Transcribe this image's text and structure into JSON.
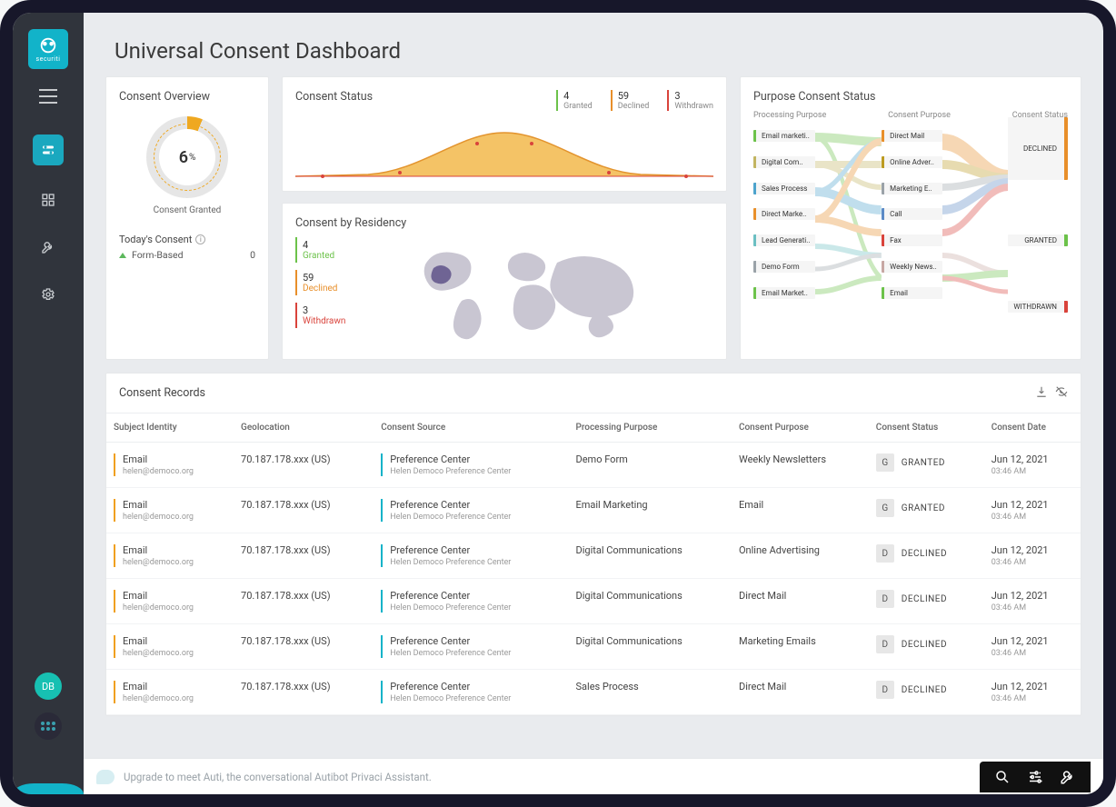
{
  "brand": {
    "name": "securiti"
  },
  "user": {
    "initials": "DB"
  },
  "header": {
    "title": "Universal Consent Dashboard"
  },
  "overview": {
    "title": "Consent Overview",
    "gauge_value": "6",
    "gauge_unit": "%",
    "gauge_label": "Consent Granted",
    "today_title": "Today's Consent",
    "today_item_label": "Form-Based",
    "today_item_value": "0"
  },
  "status": {
    "title": "Consent Status",
    "kpis": [
      {
        "value": "4",
        "label": "Granted",
        "color": "green"
      },
      {
        "value": "59",
        "label": "Declined",
        "color": "orange"
      },
      {
        "value": "3",
        "label": "Withdrawn",
        "color": "red"
      }
    ]
  },
  "residency": {
    "title": "Consent by Residency",
    "rows": [
      {
        "value": "4",
        "label": "Granted",
        "color": "green"
      },
      {
        "value": "59",
        "label": "Declined",
        "color": "orange"
      },
      {
        "value": "3",
        "label": "Withdrawn",
        "color": "red"
      }
    ]
  },
  "sankey": {
    "title": "Purpose Consent Status",
    "col_labels": [
      "Processing Purpose",
      "Consent Purpose",
      "Consent Status"
    ],
    "left": [
      {
        "label": "Email marketi..",
        "color": "#6cc24a"
      },
      {
        "label": "Digital Com..",
        "color": "#c2b561"
      },
      {
        "label": "Sales Process",
        "color": "#4da3cc"
      },
      {
        "label": "Direct Marke..",
        "color": "#e88f2a"
      },
      {
        "label": "Lead Generati..",
        "color": "#6bbfc2"
      },
      {
        "label": "Demo Form",
        "color": "#9aa2a8"
      },
      {
        "label": "Email Market..",
        "color": "#6cc24a"
      }
    ],
    "middle": [
      {
        "label": "Direct Mail",
        "color": "#e88f2a"
      },
      {
        "label": "Online Adver..",
        "color": "#bc9b21"
      },
      {
        "label": "Marketing E..",
        "color": "#9aa2a8"
      },
      {
        "label": "Call",
        "color": "#5b8ac6"
      },
      {
        "label": "Fax",
        "color": "#d9433b"
      },
      {
        "label": "Weekly News..",
        "color": "#c7a7a3"
      },
      {
        "label": "Email",
        "color": "#6cc24a"
      }
    ],
    "right": [
      {
        "label": "DECLINED",
        "color": "#e88f2a"
      },
      {
        "label": "GRANTED",
        "color": "#6cc24a"
      },
      {
        "label": "WITHDRAWN",
        "color": "#d9433b"
      }
    ]
  },
  "records": {
    "title": "Consent Records",
    "columns": [
      "Subject Identity",
      "Geolocation",
      "Consent Source",
      "Processing Purpose",
      "Consent Purpose",
      "Consent Status",
      "Consent Date"
    ],
    "rows": [
      {
        "identity_type": "Email",
        "identity_value": "helen@democo.org",
        "geo": "70.187.178.xxx (US)",
        "source_title": "Preference Center",
        "source_sub": "Helen Democo Preference Center",
        "purpose": "Demo Form",
        "consent_purpose": "Weekly Newsletters",
        "status_letter": "G",
        "status_text": "GRANTED",
        "date": "Jun 12, 2021",
        "time": "03:46 AM"
      },
      {
        "identity_type": "Email",
        "identity_value": "helen@democo.org",
        "geo": "70.187.178.xxx (US)",
        "source_title": "Preference Center",
        "source_sub": "Helen Democo Preference Center",
        "purpose": "Email Marketing",
        "consent_purpose": "Email",
        "status_letter": "G",
        "status_text": "GRANTED",
        "date": "Jun 12, 2021",
        "time": "03:46 AM"
      },
      {
        "identity_type": "Email",
        "identity_value": "helen@democo.org",
        "geo": "70.187.178.xxx (US)",
        "source_title": "Preference Center",
        "source_sub": "Helen Democo Preference Center",
        "purpose": "Digital Communications",
        "consent_purpose": "Online Advertising",
        "status_letter": "D",
        "status_text": "DECLINED",
        "date": "Jun 12, 2021",
        "time": "03:46 AM"
      },
      {
        "identity_type": "Email",
        "identity_value": "helen@democo.org",
        "geo": "70.187.178.xxx (US)",
        "source_title": "Preference Center",
        "source_sub": "Helen Democo Preference Center",
        "purpose": "Digital Communications",
        "consent_purpose": "Direct Mail",
        "status_letter": "D",
        "status_text": "DECLINED",
        "date": "Jun 12, 2021",
        "time": "03:46 AM"
      },
      {
        "identity_type": "Email",
        "identity_value": "helen@democo.org",
        "geo": "70.187.178.xxx (US)",
        "source_title": "Preference Center",
        "source_sub": "Helen Democo Preference Center",
        "purpose": "Digital Communications",
        "consent_purpose": "Marketing Emails",
        "status_letter": "D",
        "status_text": "DECLINED",
        "date": "Jun 12, 2021",
        "time": "03:46 AM"
      },
      {
        "identity_type": "Email",
        "identity_value": "helen@democo.org",
        "geo": "70.187.178.xxx (US)",
        "source_title": "Preference Center",
        "source_sub": "Helen Democo Preference Center",
        "purpose": "Sales Process",
        "consent_purpose": "Direct Mail",
        "status_letter": "D",
        "status_text": "DECLINED",
        "date": "Jun 12, 2021",
        "time": "03:46 AM"
      }
    ]
  },
  "footer": {
    "text": "Upgrade to meet Auti, the conversational Autibot Privaci Assistant."
  },
  "chart_data": {
    "type": "area",
    "title": "Consent Status",
    "x": [
      0,
      1,
      2,
      3,
      4,
      5,
      6,
      7,
      8,
      9
    ],
    "values": [
      0,
      0,
      2,
      8,
      28,
      38,
      28,
      8,
      2,
      0
    ],
    "ylim": [
      0,
      40
    ]
  }
}
